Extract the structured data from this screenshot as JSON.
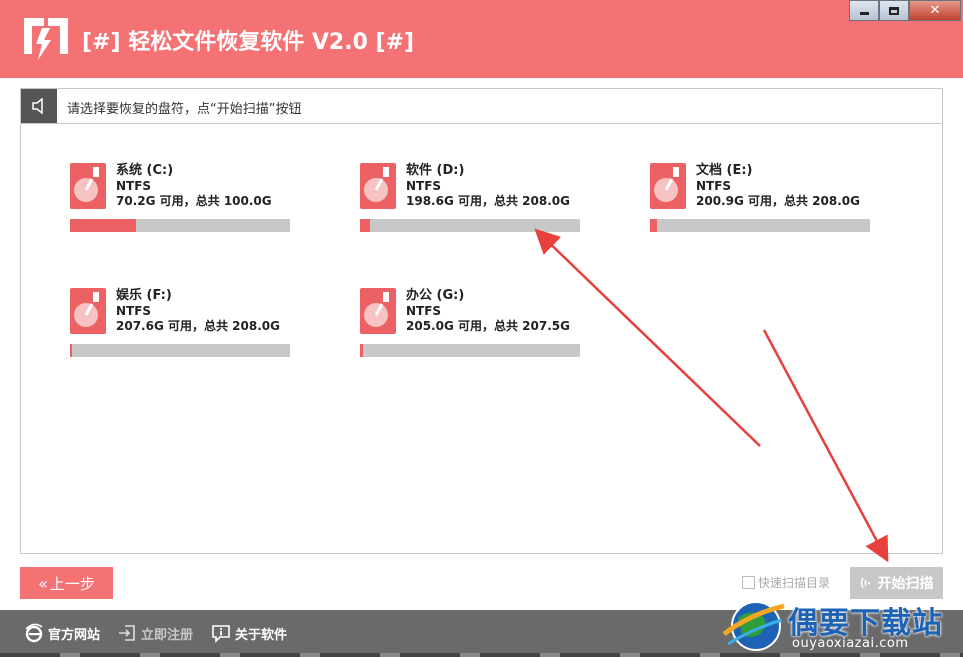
{
  "app": {
    "title": "[#] 轻松文件恢复软件 V2.0 [#]"
  },
  "window_controls": {
    "close_symbol": "✕"
  },
  "hint": {
    "text": "请选择要恢复的盘符，点“开始扫描”按钮",
    "icon": "speaker-icon"
  },
  "drives": [
    {
      "name": "系统 (C:)",
      "fs": "NTFS",
      "space": "70.2G 可用，总共 100.0G",
      "used_fraction": 0.298
    },
    {
      "name": "软件 (D:)",
      "fs": "NTFS",
      "space": "198.6G 可用，总共 208.0G",
      "used_fraction": 0.045
    },
    {
      "name": "文档 (E:)",
      "fs": "NTFS",
      "space": "200.9G 可用，总共 208.0G",
      "used_fraction": 0.034
    },
    {
      "name": "娱乐 (F:)",
      "fs": "NTFS",
      "space": "207.6G 可用，总共 208.0G",
      "used_fraction": 0.002
    },
    {
      "name": "办公 (G:)",
      "fs": "NTFS",
      "space": "205.0G 可用，总共 207.5G",
      "used_fraction": 0.012
    }
  ],
  "buttons": {
    "back_label": "上一步",
    "back_chevrons": "«",
    "scan_label": "开始扫描",
    "quick_scan_label": "快速扫描目录"
  },
  "footer": {
    "website_label": "官方网站",
    "register_label": "立即注册",
    "about_label": "关于软件"
  },
  "watermark": {
    "title": "偶要下载站",
    "url": "ouyaoxiazai.com"
  },
  "colors": {
    "accent": "#f47174",
    "usage_fill": "#ec6163",
    "bar_track": "#c8c8c8",
    "footer_bg": "#6a6a6a",
    "annotation_arrow": "#e8403c"
  }
}
